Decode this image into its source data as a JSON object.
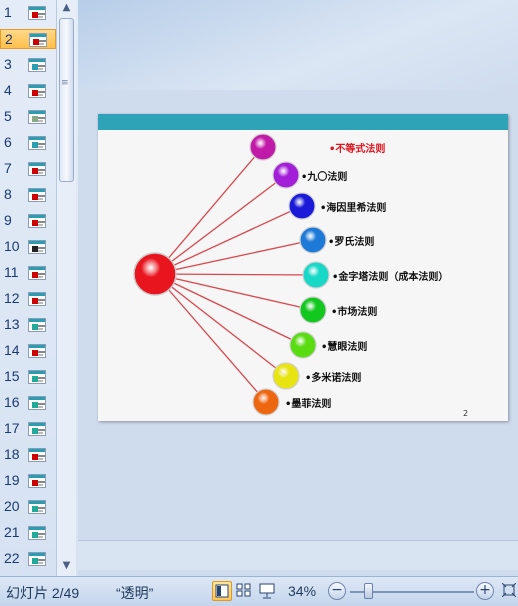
{
  "thumbnails": {
    "selected_index": 1,
    "items": [
      {
        "num": "1"
      },
      {
        "num": "2"
      },
      {
        "num": "3"
      },
      {
        "num": "4"
      },
      {
        "num": "5"
      },
      {
        "num": "6"
      },
      {
        "num": "7"
      },
      {
        "num": "8"
      },
      {
        "num": "9"
      },
      {
        "num": "10"
      },
      {
        "num": "11"
      },
      {
        "num": "12"
      },
      {
        "num": "13"
      },
      {
        "num": "14"
      },
      {
        "num": "15"
      },
      {
        "num": "16"
      },
      {
        "num": "17"
      },
      {
        "num": "18"
      },
      {
        "num": "19"
      },
      {
        "num": "20"
      },
      {
        "num": "21"
      },
      {
        "num": "22"
      }
    ]
  },
  "slide": {
    "header_color": "#2ea3b8",
    "center_ball_color": "#e8141e",
    "laws": [
      {
        "label": "•不等式法则",
        "color": "#c21aa8",
        "label_color": "#e0141e"
      },
      {
        "label": "•九〇法则",
        "color": "#a21ed8"
      },
      {
        "label": "•海因里希法则",
        "color": "#1a1ad8"
      },
      {
        "label": "•罗氏法则",
        "color": "#1e7ad8"
      },
      {
        "label": "•金字塔法则（成本法则）",
        "color": "#18d8c8"
      },
      {
        "label": "•市场法则",
        "color": "#12c81e"
      },
      {
        "label": "•慧眼法则",
        "color": "#5adc12"
      },
      {
        "label": "•多米诺法则",
        "color": "#e8e412"
      },
      {
        "label": "•墨菲法则",
        "color": "#ee6610"
      }
    ],
    "page_number": "2"
  },
  "statusbar": {
    "slide_info": "幻灯片 2/49",
    "theme": "“透明”",
    "zoom": "34%",
    "zoom_out": "−",
    "zoom_in": "+"
  }
}
